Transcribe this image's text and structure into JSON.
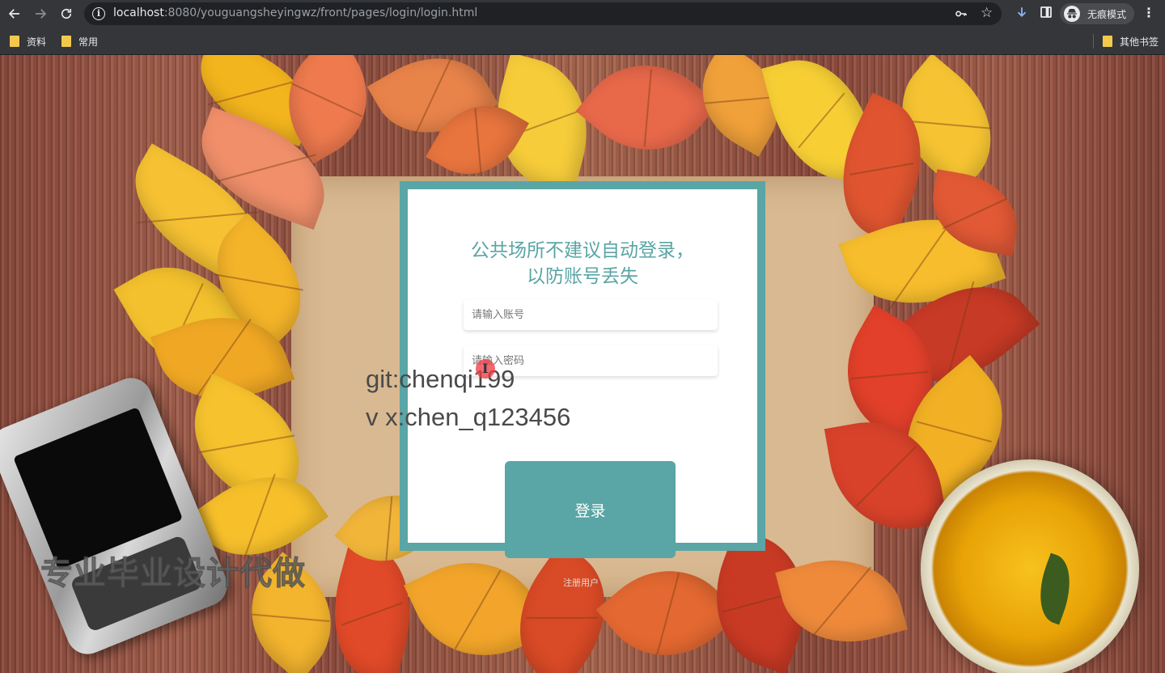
{
  "browser": {
    "url_host": "localhost",
    "url_rest": ":8080/youguangsheyingwz/front/pages/login/login.html",
    "incognito_label": "无痕模式",
    "bookmarks": [
      {
        "label": "资料"
      },
      {
        "label": "常用"
      }
    ],
    "other_bookmarks": "其他书签"
  },
  "login": {
    "title_line1": "公共场所不建议自动登录，",
    "title_line2": "以防账号丢失",
    "username_placeholder": "请输入账号",
    "password_placeholder": "请输入密码",
    "submit_label": "登录",
    "register_link": "注册用户"
  },
  "overlay": {
    "git": "git:chenqi199",
    "vx": "v x:chen_q123456",
    "watermark": "专业毕业设计代做"
  },
  "colors": {
    "accent": "#5aa5a5",
    "browser_chrome": "#35363a",
    "omnibox": "#202124"
  }
}
